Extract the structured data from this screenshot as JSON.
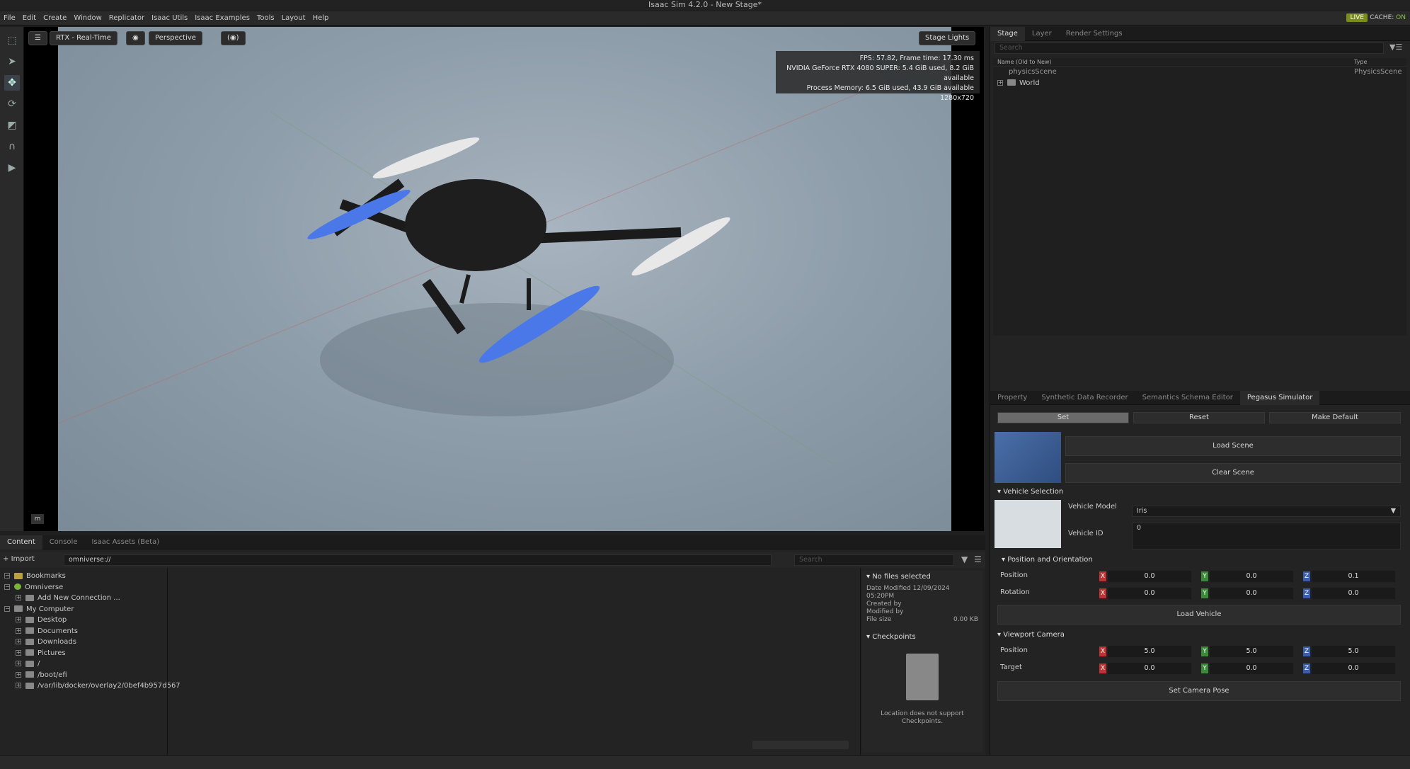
{
  "window": {
    "title": "Isaac Sim 4.2.0 - New Stage*"
  },
  "menu": [
    "File",
    "Edit",
    "Create",
    "Window",
    "Replicator",
    "Isaac Utils",
    "Isaac Examples",
    "Tools",
    "Layout",
    "Help"
  ],
  "status": {
    "live": "LIVE",
    "cache_label": "CACHE:",
    "cache_value": "ON"
  },
  "viewport": {
    "renderer": "RTX - Real-Time",
    "camera": "Perspective",
    "lights": "Stage Lights",
    "stats": {
      "fps": "FPS: 57.82, Frame time: 17.30 ms",
      "gpu": "NVIDIA GeForce RTX 4080 SUPER: 5.4 GiB used, 8.2 GiB available",
      "memory": "Process Memory: 6.5 GiB used, 43.9 GiB available",
      "resolution": "1280x720"
    },
    "axis_unit": "m"
  },
  "content": {
    "tabs": [
      "Content",
      "Console",
      "Isaac Assets (Beta)"
    ],
    "import_label": "Import",
    "path": "omniverse://",
    "search_placeholder": "Search",
    "tree": [
      "Bookmarks",
      "Omniverse",
      "Add New Connection ...",
      "My Computer",
      "Desktop",
      "Documents",
      "Downloads",
      "Pictures",
      "/",
      "/boot/efi",
      "/var/lib/docker/overlay2/0bef4b957d567"
    ],
    "info": {
      "no_files": "No files selected",
      "date_modified_label": "Date Modified",
      "date_modified": "12/09/2024 05:20PM",
      "created_by": "Created by",
      "modified_by": "Modified by",
      "file_size_label": "File size",
      "file_size": "0.00 KB",
      "checkpoints": "Checkpoints",
      "no_checkpoints_1": "Location does not support",
      "no_checkpoints_2": "Checkpoints."
    }
  },
  "stage": {
    "tabs": [
      "Stage",
      "Layer",
      "Render Settings"
    ],
    "search_placeholder": "Search",
    "col_name": "Name (Old to New)",
    "col_type": "Type",
    "items": [
      {
        "name": "physicsScene",
        "type": "PhysicsScene"
      },
      {
        "name": "World",
        "type": ""
      }
    ]
  },
  "property": {
    "tabs": [
      "Property",
      "Synthetic Data Recorder",
      "Semantics Schema Editor",
      "Pegasus Simulator"
    ],
    "set": "Set",
    "reset": "Reset",
    "make_default": "Make Default",
    "load_scene": "Load Scene",
    "clear_scene": "Clear Scene",
    "vehicle_selection": "Vehicle Selection",
    "vehicle_model_label": "Vehicle Model",
    "vehicle_model": "Iris",
    "vehicle_id_label": "Vehicle ID",
    "vehicle_id": "0",
    "pos_orient": "Position and Orientation",
    "position_label": "Position",
    "rotation_label": "Rotation",
    "position": [
      "0.0",
      "0.0",
      "0.1"
    ],
    "rotation": [
      "0.0",
      "0.0",
      "0.0"
    ],
    "load_vehicle": "Load Vehicle",
    "viewport_camera": "Viewport Camera",
    "target_label": "Target",
    "cam_position": [
      "5.0",
      "5.0",
      "5.0"
    ],
    "cam_target": [
      "0.0",
      "0.0",
      "0.0"
    ],
    "set_camera_pose": "Set Camera Pose",
    "axes": [
      "X",
      "Y",
      "Z"
    ]
  }
}
